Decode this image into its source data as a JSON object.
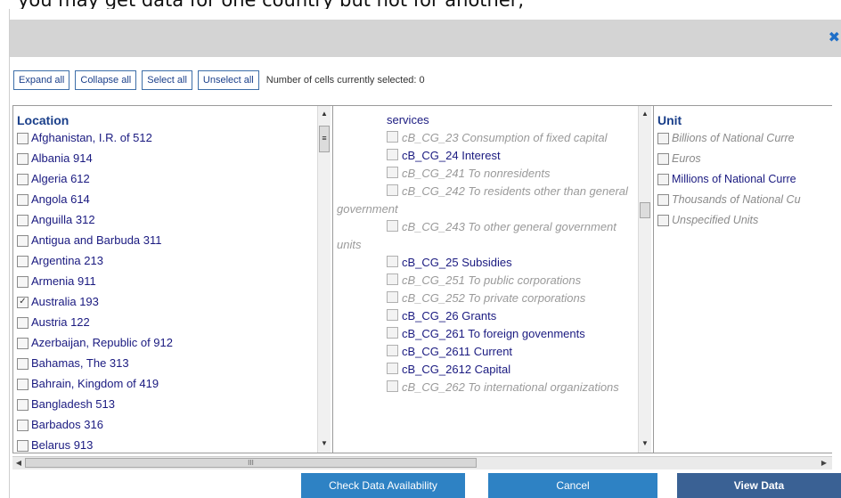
{
  "caption": "you may get data for one country but not for another,",
  "dialog": {
    "close_glyph": "✖"
  },
  "toolbar": {
    "expand_all": "Expand all",
    "collapse_all": "Collapse all",
    "select_all": "Select all",
    "unselect_all": "Unselect all",
    "cells_selected": "Number of cells currently selected: 0"
  },
  "location": {
    "title": "Location",
    "items": [
      {
        "label": "Afghanistan, I.R. of 512",
        "checked": false
      },
      {
        "label": "Albania 914",
        "checked": false
      },
      {
        "label": "Algeria 612",
        "checked": false
      },
      {
        "label": "Angola 614",
        "checked": false
      },
      {
        "label": "Anguilla 312",
        "checked": false
      },
      {
        "label": "Antigua and Barbuda 311",
        "checked": false
      },
      {
        "label": "Argentina 213",
        "checked": false
      },
      {
        "label": "Armenia 911",
        "checked": false
      },
      {
        "label": "Australia 193",
        "checked": true
      },
      {
        "label": "Austria 122",
        "checked": false
      },
      {
        "label": "Azerbaijan, Republic of 912",
        "checked": false
      },
      {
        "label": "Bahamas, The 313",
        "checked": false
      },
      {
        "label": "Bahrain, Kingdom of 419",
        "checked": false
      },
      {
        "label": "Bangladesh 513",
        "checked": false
      },
      {
        "label": "Barbados 316",
        "checked": false
      },
      {
        "label": "Belarus 913",
        "checked": false
      }
    ]
  },
  "indicator": {
    "items": [
      {
        "label": "services",
        "enabled": true,
        "checkbox": false
      },
      {
        "label": "cB_CG_23 Consumption of fixed capital",
        "enabled": false,
        "checkbox": true
      },
      {
        "label": "cB_CG_24 Interest",
        "enabled": true,
        "checkbox": true
      },
      {
        "label": "cB_CG_241 To nonresidents",
        "enabled": false,
        "checkbox": true
      },
      {
        "label": "cB_CG_242 To residents other than general government",
        "enabled": false,
        "checkbox": true
      },
      {
        "label": "cB_CG_243 To other general government units",
        "enabled": false,
        "checkbox": true
      },
      {
        "label": "cB_CG_25 Subsidies",
        "enabled": true,
        "checkbox": true
      },
      {
        "label": "cB_CG_251 To public corporations",
        "enabled": false,
        "checkbox": true
      },
      {
        "label": "cB_CG_252 To private corporations",
        "enabled": false,
        "checkbox": true
      },
      {
        "label": "cB_CG_26 Grants",
        "enabled": true,
        "checkbox": true
      },
      {
        "label": "cB_CG_261 To foreign govenments",
        "enabled": true,
        "checkbox": true
      },
      {
        "label": "cB_CG_2611 Current",
        "enabled": true,
        "checkbox": true
      },
      {
        "label": "cB_CG_2612 Capital",
        "enabled": true,
        "checkbox": true
      },
      {
        "label": "cB_CG_262 To international organizations",
        "enabled": false,
        "checkbox": true
      }
    ]
  },
  "unit": {
    "title": "Unit",
    "items": [
      {
        "label": "Billions of National Curre",
        "enabled": false
      },
      {
        "label": "Euros",
        "enabled": false
      },
      {
        "label": "Millions of National Curre",
        "enabled": true
      },
      {
        "label": "Thousands of National Cu",
        "enabled": false
      },
      {
        "label": "Unspecified Units",
        "enabled": false
      }
    ]
  },
  "scroll_glyphs": {
    "up": "▲",
    "down": "▼",
    "left": "◀",
    "right": "▶",
    "grip": "III",
    "grip_v": "≡"
  },
  "buttons": {
    "check": "Check Data Availability",
    "cancel": "Cancel",
    "view": "View Data"
  }
}
